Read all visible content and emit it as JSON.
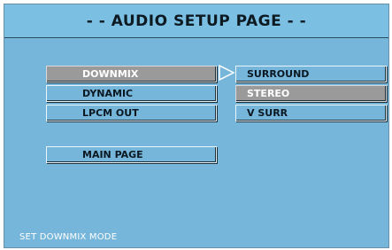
{
  "header": {
    "title": "- - AUDIO SETUP PAGE - -"
  },
  "menu": {
    "items": [
      {
        "label": "DOWNMIX",
        "selected": true
      },
      {
        "label": "DYNAMIC",
        "selected": false
      },
      {
        "label": "LPCM OUT",
        "selected": false
      }
    ],
    "main_page_label": "MAIN PAGE"
  },
  "submenu": {
    "arrow_icon": "arrow-right-icon",
    "options": [
      {
        "label": "SURROUND",
        "selected": false
      },
      {
        "label": "STEREO",
        "selected": true
      },
      {
        "label": "V SURR",
        "selected": false
      }
    ]
  },
  "status": {
    "text": "SET DOWNMIX MODE"
  },
  "colors": {
    "background": "#76b6da",
    "highlight": "#9a9a9a",
    "text": "#0b1822"
  }
}
